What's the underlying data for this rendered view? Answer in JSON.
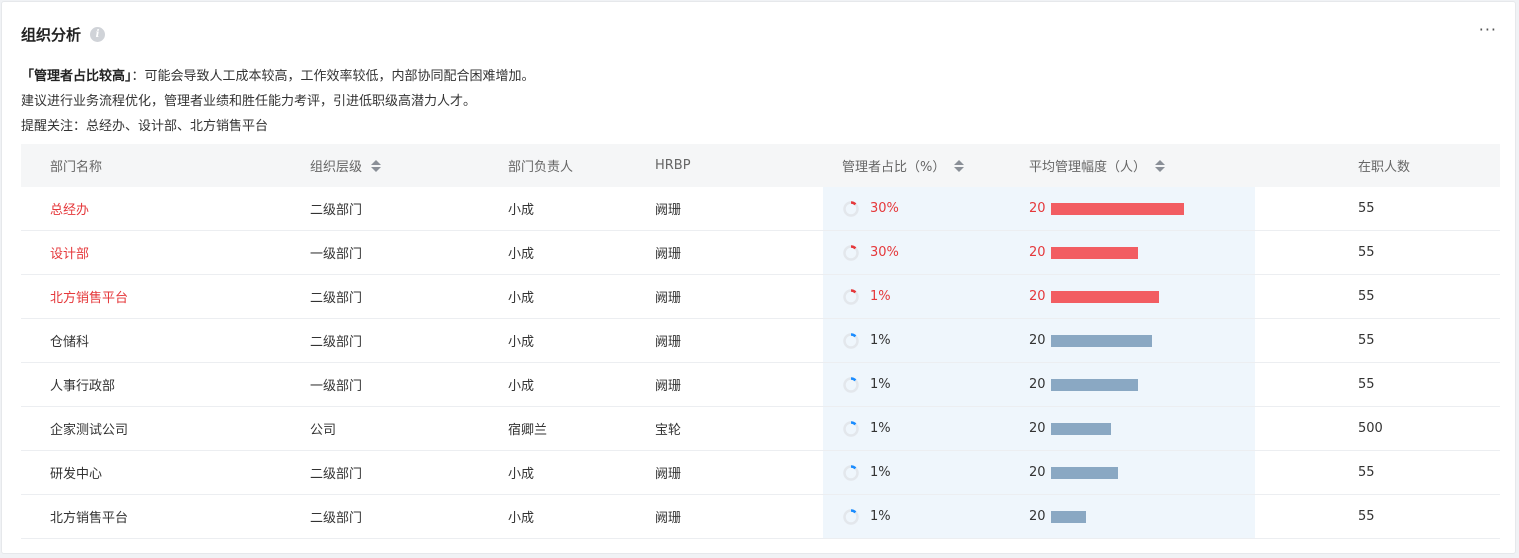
{
  "header": {
    "title": "组织分析",
    "info_icon": "info-icon",
    "more": "···"
  },
  "description": {
    "highlight": "「管理者占比较高」",
    "line1_rest": "：可能会导致人工成本较高，工作效率较低，内部协同配合困难增加。",
    "line2": "建议进行业务流程优化，管理者业绩和胜任能力考评，引进低职级高潜力人才。",
    "line3": "提醒关注：总经办、设计部、北方销售平台"
  },
  "colors": {
    "alert": "#e5383b",
    "bar_alert": "#f25d62",
    "bar_normal": "#8aa8c3",
    "ring_normal": "#1a8cff",
    "highlight_bg": "#eff6fc"
  },
  "table": {
    "columns": [
      "部门名称",
      "组织层级",
      "部门负责人",
      "HRBP",
      "管理者占比（%）",
      "平均管理幅度（人）",
      "在职人数"
    ],
    "rows": [
      {
        "name": "总经办",
        "level": "二级部门",
        "leader": "小成",
        "hrbp": "阙珊",
        "ratio": "30%",
        "ratio_value": 0.3,
        "span": "20",
        "span_bar": 0.58,
        "headcount": "55",
        "alert": true
      },
      {
        "name": "设计部",
        "level": "一级部门",
        "leader": "小成",
        "hrbp": "阙珊",
        "ratio": "30%",
        "ratio_value": 0.3,
        "span": "20",
        "span_bar": 0.38,
        "headcount": "55",
        "alert": true
      },
      {
        "name": "北方销售平台",
        "level": "二级部门",
        "leader": "小成",
        "hrbp": "阙珊",
        "ratio": "1%",
        "ratio_value": 0.3,
        "span": "20",
        "span_bar": 0.47,
        "headcount": "55",
        "alert": true
      },
      {
        "name": "仓储科",
        "level": "二级部门",
        "leader": "小成",
        "hrbp": "阙珊",
        "ratio": "1%",
        "ratio_value": 0.2,
        "span": "20",
        "span_bar": 0.44,
        "headcount": "55",
        "alert": false
      },
      {
        "name": "人事行政部",
        "level": "一级部门",
        "leader": "小成",
        "hrbp": "阙珊",
        "ratio": "1%",
        "ratio_value": 0.25,
        "span": "20",
        "span_bar": 0.38,
        "headcount": "55",
        "alert": false
      },
      {
        "name": "企家测试公司",
        "level": "公司",
        "leader": "宿卿兰",
        "hrbp": "宝轮",
        "ratio": "1%",
        "ratio_value": 0.22,
        "span": "20",
        "span_bar": 0.26,
        "headcount": "500",
        "alert": false
      },
      {
        "name": "研发中心",
        "level": "二级部门",
        "leader": "小成",
        "hrbp": "阙珊",
        "ratio": "1%",
        "ratio_value": 0.2,
        "span": "20",
        "span_bar": 0.29,
        "headcount": "55",
        "alert": false
      },
      {
        "name": "北方销售平台",
        "level": "二级部门",
        "leader": "小成",
        "hrbp": "阙珊",
        "ratio": "1%",
        "ratio_value": 0.18,
        "span": "20",
        "span_bar": 0.15,
        "headcount": "55",
        "alert": false
      }
    ]
  }
}
